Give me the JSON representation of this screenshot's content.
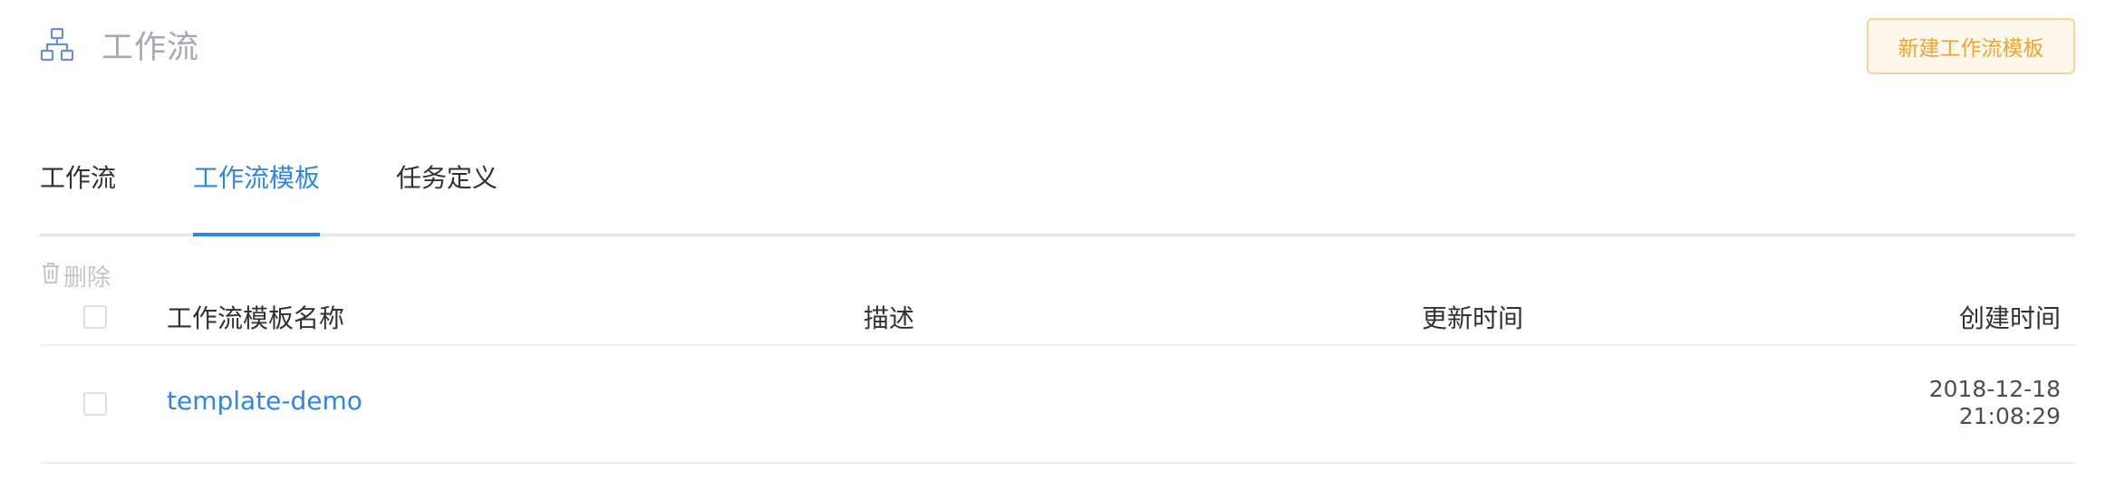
{
  "header": {
    "title": "工作流",
    "icon": "workflow-hierarchy-icon",
    "new_button_label": "新建工作流模板",
    "accent_color": "#f0a62a"
  },
  "tabs": [
    {
      "label": "工作流",
      "active": false
    },
    {
      "label": "工作流模板",
      "active": true
    },
    {
      "label": "任务定义",
      "active": false
    }
  ],
  "toolbar": {
    "delete_label": "删除",
    "delete_icon": "trash-icon"
  },
  "table": {
    "columns": [
      "工作流模板名称",
      "描述",
      "更新时间",
      "创建时间"
    ],
    "rows": [
      {
        "name": "template-demo",
        "description": "",
        "updated": "",
        "created_date": "2018-12-18",
        "created_time": "21:08:29"
      }
    ]
  },
  "colors": {
    "link": "#2e86e8",
    "muted": "#a4a9b3"
  }
}
